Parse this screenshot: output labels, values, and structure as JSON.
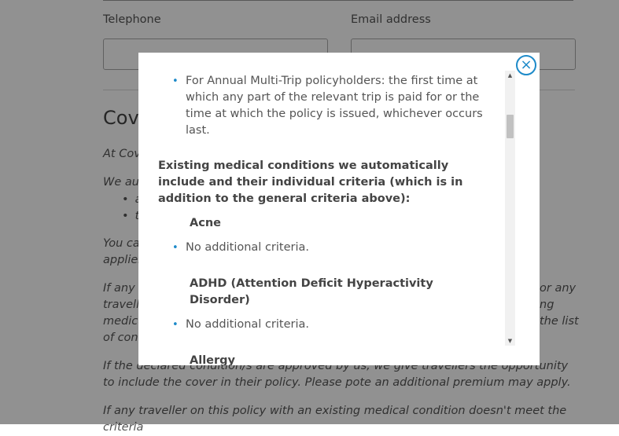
{
  "form": {
    "telephone_label": "Telephone",
    "email_label": "Email address"
  },
  "background": {
    "section_title": "Cove",
    "para1": "At Cov",
    "para2": "We aut",
    "bullets": [
      "a",
      "t"
    ],
    "para3_line1": "You ca",
    "para3_line2": "applies",
    "para4_lines": [
      "If any t",
      "travelle",
      "medica",
      "of cond"
    ],
    "para4_right_lines": [
      "or any",
      "ng",
      "the list"
    ],
    "para5": "If the declared condition/s are approved by us, we give travellers the opportunity to include the cover in their policy. Please pote an additional premium may apply.",
    "para6": "If any traveller on this policy with an existing medical condition doesn't meet the criteria"
  },
  "modal": {
    "intro_bullet": "For Annual Multi-Trip policyholders: the first time at which any part of the relevant trip is paid for or the time at which the policy is issued, whichever occurs last.",
    "heading": "Existing medical conditions we automatically include and their individual criteria (which is in addition to the general criteria above):",
    "conditions": [
      {
        "name": "Acne",
        "criteria": "No additional criteria."
      },
      {
        "name": "ADHD (Attention Deficit Hyperactivity Disorder)",
        "criteria": "No additional criteria."
      },
      {
        "name": "Allergy",
        "criteria": ""
      }
    ],
    "close_symbol": "×"
  },
  "colors": {
    "accent": "#1d8ac9",
    "overlay": "rgba(0,0,0,0.43)"
  }
}
